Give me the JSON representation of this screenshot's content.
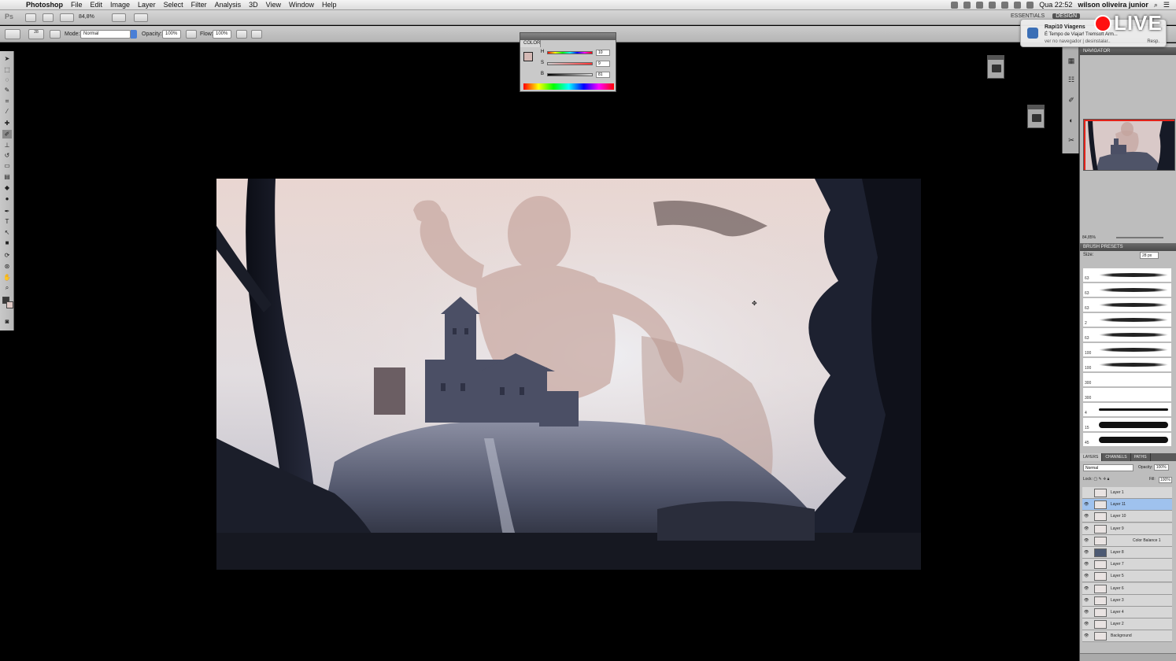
{
  "menubar": {
    "app_name": "Photoshop",
    "menus": [
      "File",
      "Edit",
      "Image",
      "Layer",
      "Select",
      "Filter",
      "Analysis",
      "3D",
      "View",
      "Window",
      "Help"
    ],
    "clock": "Qua 22:52",
    "user": "wilson oliveira junior"
  },
  "appbar": {
    "zoom": "84,8%",
    "workspaces": [
      "ESSENTIALS",
      "DESIGN"
    ]
  },
  "options": {
    "mode_label": "Mode:",
    "mode_value": "Normal",
    "opacity_label": "Opacity:",
    "opacity_value": "100%",
    "flow_label": "Flow:",
    "flow_value": "100%",
    "brush_size": "28"
  },
  "color_panel": {
    "title": "COLOR",
    "channels": [
      {
        "label": "H",
        "value": "10"
      },
      {
        "label": "S",
        "value": "9"
      },
      {
        "label": "B",
        "value": "81"
      }
    ],
    "swatch_color": "#d5b9b5"
  },
  "notification": {
    "title": "Rapi10 Viagens",
    "body": "É Tempo de Viajar! Tremsoft Arm...",
    "sub": "ver no navegador | desinstalar..",
    "action": "Resp."
  },
  "live_badge": "LIVE",
  "navigator": {
    "title": "NAVIGATOR",
    "zoom": "84,85%"
  },
  "brush_presets": {
    "title": "BRUSH PRESETS",
    "size_label": "Size:",
    "size_value": "28 px",
    "sizes": [
      "63",
      "63",
      "63",
      "2",
      "63",
      "100",
      "100",
      "300",
      "300",
      "4",
      "15",
      "45"
    ]
  },
  "layers": {
    "tabs": [
      "LAYERS",
      "CHANNELS",
      "PATHS"
    ],
    "blend_mode": "Normal",
    "opacity_label": "Opacity:",
    "opacity_value": "100%",
    "lock_label": "Lock:",
    "fill_label": "Fill:",
    "fill_value": "100%",
    "items": [
      {
        "name": "Layer 1",
        "visible": false,
        "selected": false
      },
      {
        "name": "Layer 11",
        "visible": true,
        "selected": true
      },
      {
        "name": "Layer 10",
        "visible": true,
        "selected": false
      },
      {
        "name": "Layer 9",
        "visible": true,
        "selected": false
      },
      {
        "name": "Color Balance 1",
        "visible": true,
        "selected": false
      },
      {
        "name": "Layer 8",
        "visible": true,
        "selected": false
      },
      {
        "name": "Layer 7",
        "visible": true,
        "selected": false
      },
      {
        "name": "Layer 5",
        "visible": true,
        "selected": false
      },
      {
        "name": "Layer 6",
        "visible": true,
        "selected": false
      },
      {
        "name": "Layer 3",
        "visible": true,
        "selected": false
      },
      {
        "name": "Layer 4",
        "visible": true,
        "selected": false
      },
      {
        "name": "Layer 2",
        "visible": true,
        "selected": false
      },
      {
        "name": "Background",
        "visible": true,
        "selected": false
      }
    ]
  },
  "colors": {
    "selected_layer": "#9fc2ee",
    "live_red": "#ff1010",
    "navigator_frame": "#e2231a"
  }
}
